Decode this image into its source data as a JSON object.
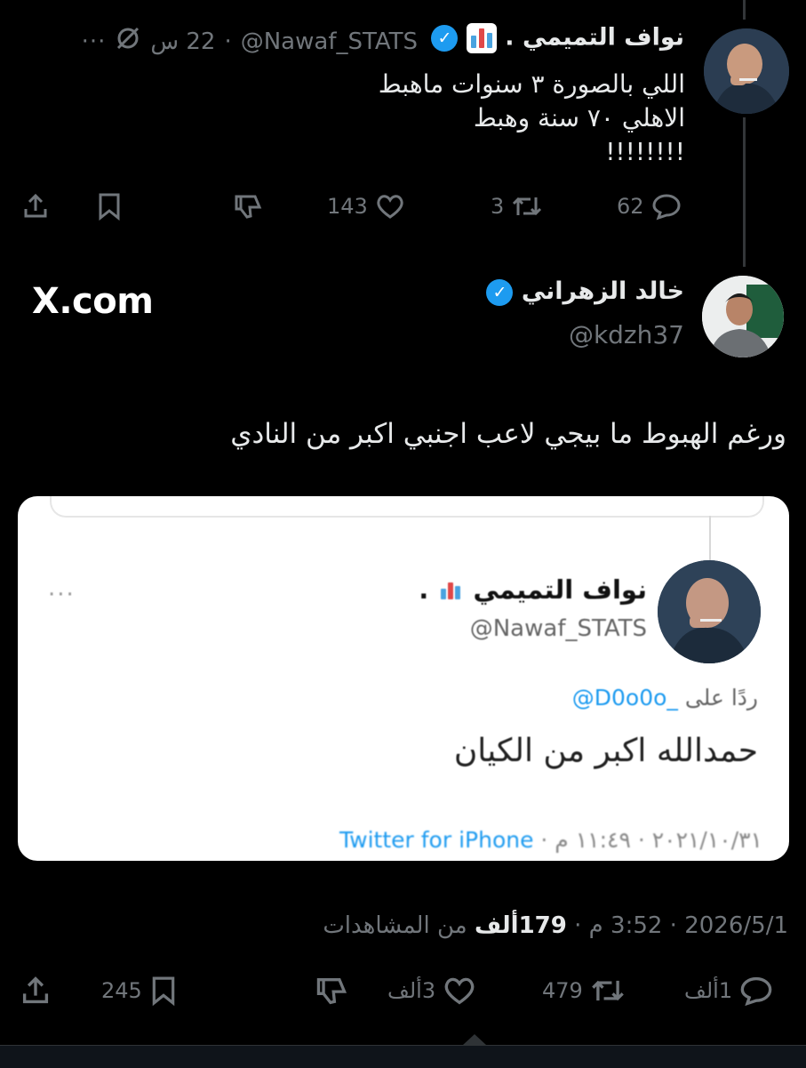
{
  "tweet1": {
    "name": "نواف التميمي",
    "name_dot": ".",
    "handle": "@Nawaf_STATS",
    "time": "22 س",
    "text": "اللي بالصورة ٣ سنوات ماهبط\nالاهلي ٧٠ سنة وهبط\n!!!!!!!!",
    "replies": "62",
    "retweets": "3",
    "likes": "143"
  },
  "tweet2": {
    "name": "خالد الزهراني",
    "handle": "@kdzh37",
    "brand": "X.com",
    "text": "ورغم الهبوط ما بيجي لاعب اجنبي اكبر من النادي",
    "timestamp_date": "2026/5/1",
    "timestamp_time": "3:52 م",
    "views_count": "179ألف",
    "views_label": "من المشاهدات",
    "replies": "1ألف",
    "retweets": "479",
    "likes": "3ألف",
    "bookmarks": "245"
  },
  "embedded": {
    "name": "نواف التميمي",
    "name_dot": ".",
    "handle": "@Nawaf_STATS",
    "reply_prefix": "ردًا على",
    "reply_handle": "@D0o0o_",
    "text": "حمدالله اكبر من الكيان",
    "footer_date": "٢٠٢١/١٠/٣١ · ١١:٤٩ م · ",
    "footer_source": "Twitter for iPhone",
    "more": "···"
  },
  "colors": {
    "background": "#000000",
    "text": "#e7e9ea",
    "muted": "#71767b",
    "verified": "#1d9bf0"
  },
  "icons": [
    "more-icon",
    "mute-icon",
    "verified-icon",
    "chart-bars-icon",
    "reply-icon",
    "retweet-icon",
    "like-icon",
    "dislike-icon",
    "bookmark-icon",
    "share-icon"
  ]
}
